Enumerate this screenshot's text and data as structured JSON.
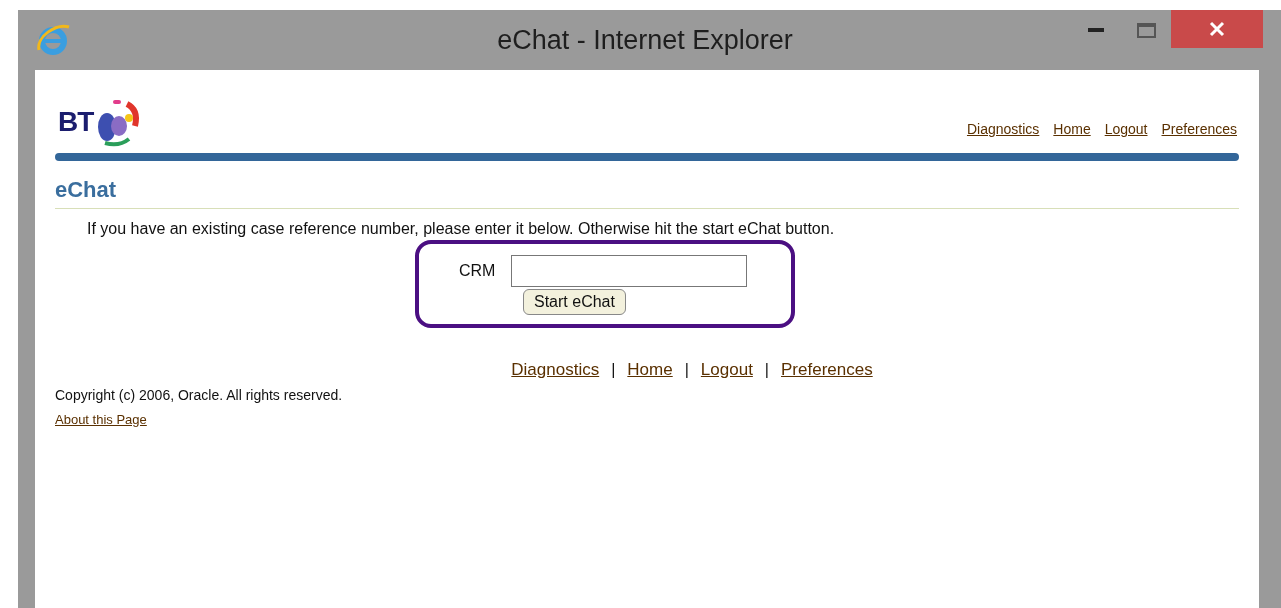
{
  "window": {
    "title": "eChat - Internet Explorer"
  },
  "header": {
    "logo_text": "BT",
    "links": [
      "Diagnostics",
      "Home",
      "Logout",
      "Preferences"
    ]
  },
  "page": {
    "heading": "eChat",
    "instruction": "If you have an existing case reference number, please enter it below. Otherwise hit the start eChat button.",
    "field_label": "CRM",
    "button": "Start eChat"
  },
  "footer": {
    "links": [
      "Diagnostics",
      "Home",
      "Logout",
      "Preferences"
    ],
    "separator": "|",
    "copyright": "Copyright (c) 2006, Oracle. All rights reserved.",
    "about_link": "About this Page"
  }
}
